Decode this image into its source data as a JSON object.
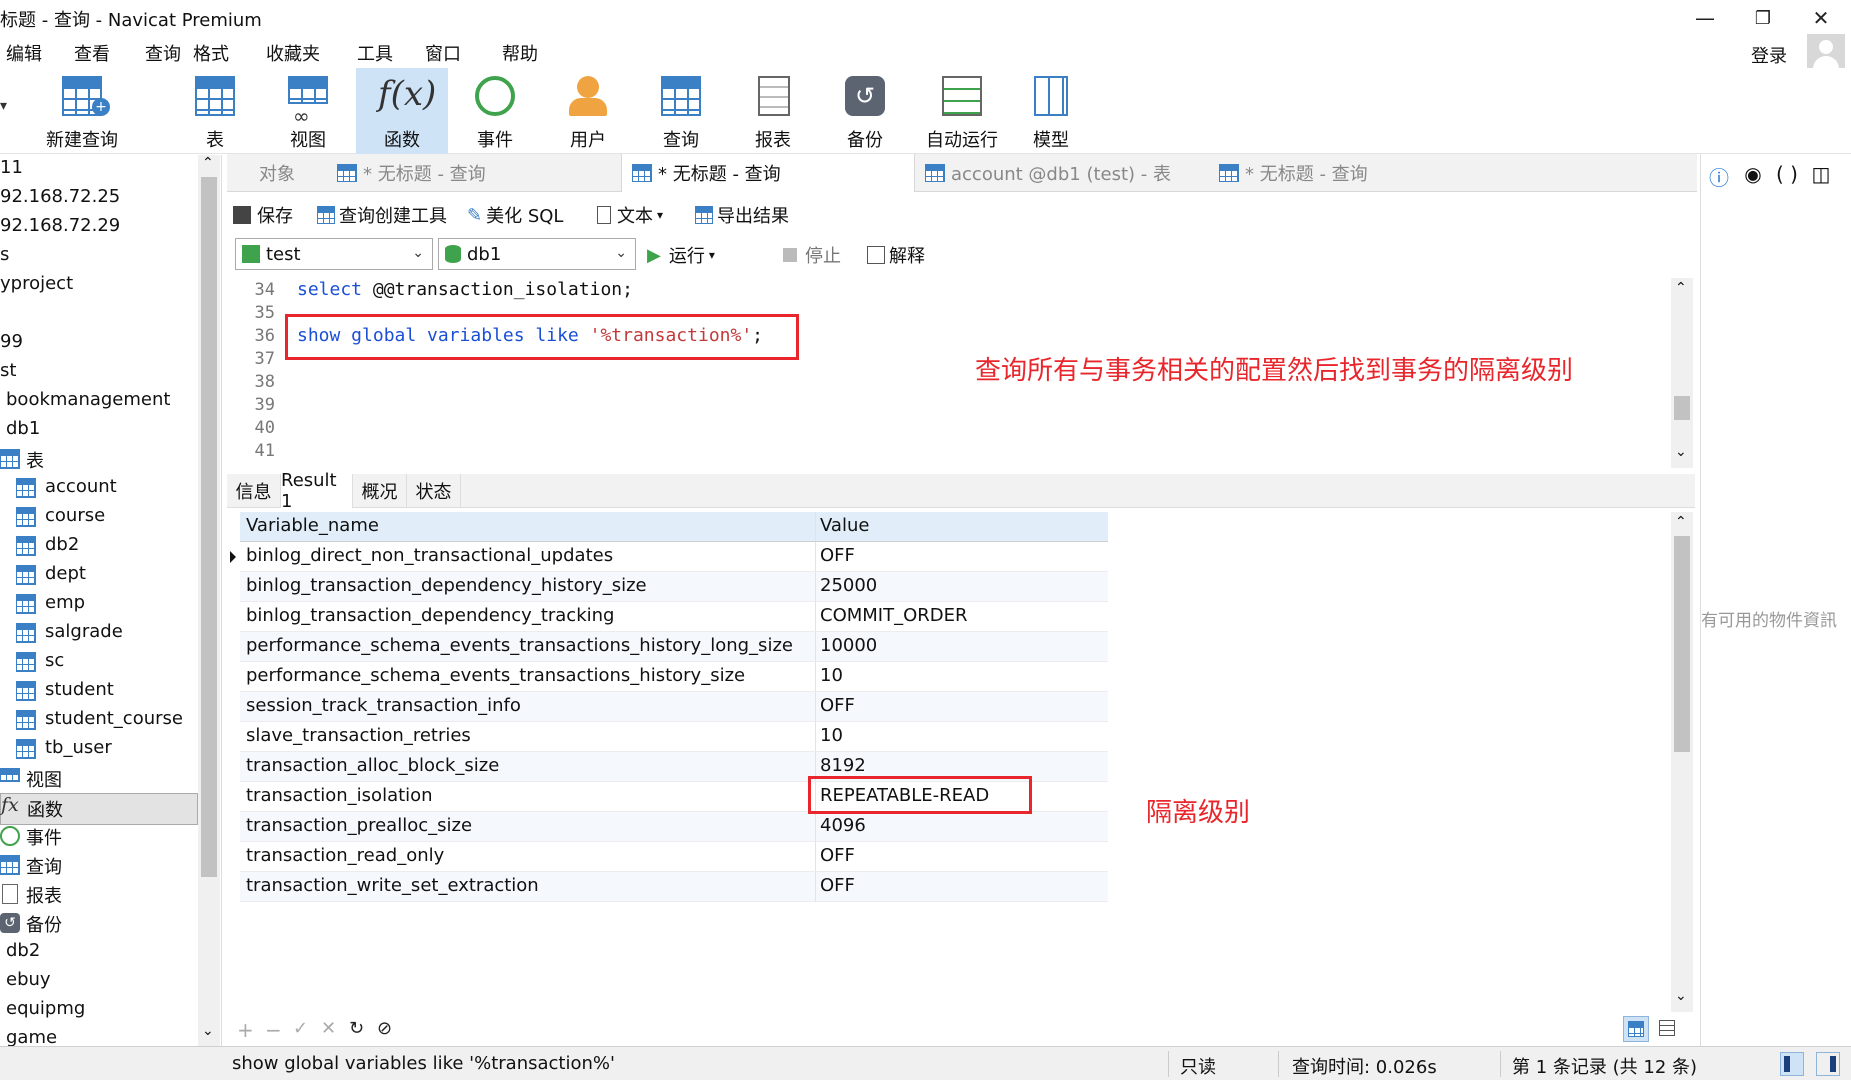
{
  "window": {
    "title": "标题 - 查询 - Navicat Premium",
    "minimize": "—",
    "maximize": "❐",
    "close": "✕"
  },
  "menu": {
    "items": [
      "编辑",
      "查看",
      "查询",
      "格式",
      "收藏夹",
      "工具",
      "窗口",
      "帮助"
    ],
    "login": "登录"
  },
  "toolbar": {
    "items": [
      "新建查询",
      "表",
      "视图",
      "函数",
      "事件",
      "用户",
      "查询",
      "报表",
      "备份",
      "自动运行",
      "模型"
    ],
    "active": "函数"
  },
  "tree": {
    "items": [
      "11",
      "92.168.72.25",
      "92.168.72.29",
      "s",
      "yproject",
      "99",
      "st",
      "bookmanagement",
      "db1",
      "表",
      "account",
      "course",
      "db2",
      "dept",
      "emp",
      "salgrade",
      "sc",
      "student",
      "student_course",
      "tb_user",
      "视图",
      "函数",
      "事件",
      "查询",
      "报表",
      "备份",
      "db2",
      "ebuy",
      "equipmg",
      "game"
    ]
  },
  "tabs": [
    {
      "label": "对象"
    },
    {
      "label": "* 无标题 - 查询"
    },
    {
      "label": "* 无标题 - 查询"
    },
    {
      "label": "account @db1 (test) - 表"
    },
    {
      "label": "* 无标题 - 查询"
    }
  ],
  "querytools": {
    "save": "保存",
    "builder": "查询创建工具",
    "beautify": "美化 SQL",
    "text": "文本",
    "export": "导出结果",
    "run": "运行",
    "stop": "停止",
    "explain": "解释"
  },
  "connection": {
    "conn": "test",
    "db": "db1"
  },
  "editor": {
    "line_numbers": [
      "34",
      "35",
      "36",
      "37",
      "38",
      "39",
      "40",
      "41"
    ],
    "line34": {
      "kw": "select",
      "rest": " @@transaction_isolation;"
    },
    "line36": {
      "kw": "show global variables like",
      "str": "'%transaction%'",
      "end": ";"
    },
    "annotation": "查询所有与事务相关的配置然后找到事务的隔离级别"
  },
  "result_tabs": [
    "信息",
    "Result 1",
    "概况",
    "状态"
  ],
  "grid": {
    "headers": [
      "Variable_name",
      "Value"
    ],
    "rows": [
      [
        "binlog_direct_non_transactional_updates",
        "OFF"
      ],
      [
        "binlog_transaction_dependency_history_size",
        "25000"
      ],
      [
        "binlog_transaction_dependency_tracking",
        "COMMIT_ORDER"
      ],
      [
        "performance_schema_events_transactions_history_long_size",
        "10000"
      ],
      [
        "performance_schema_events_transactions_history_size",
        "10"
      ],
      [
        "session_track_transaction_info",
        "OFF"
      ],
      [
        "slave_transaction_retries",
        "10"
      ],
      [
        "transaction_alloc_block_size",
        "8192"
      ],
      [
        "transaction_isolation",
        "REPEATABLE-READ"
      ],
      [
        "transaction_prealloc_size",
        "4096"
      ],
      [
        "transaction_read_only",
        "OFF"
      ],
      [
        "transaction_write_set_extraction",
        "OFF"
      ]
    ],
    "annotation": "隔离级别"
  },
  "rightpanel": {
    "message": "有可用的物件資訊"
  },
  "status": {
    "sql": "show global variables like '%transaction%'",
    "mode": "只读",
    "time": "查询时间: 0.026s",
    "records": "第 1 条记录 (共 12 条)"
  },
  "colors": {
    "accent": "#3b7fc4",
    "annotation": "#e8262b",
    "active_tool": "#cfe3f7"
  }
}
